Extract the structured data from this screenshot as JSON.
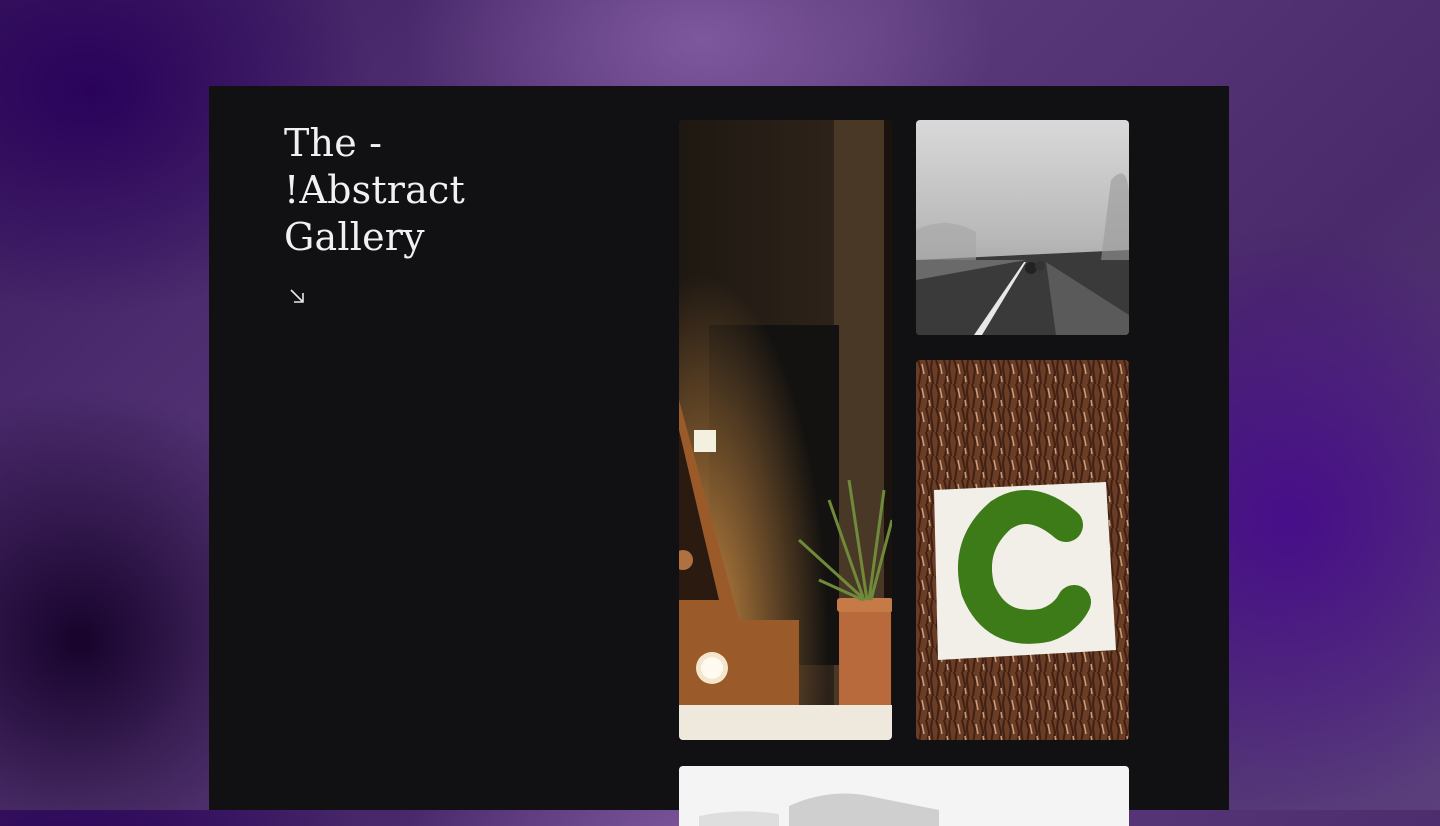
{
  "gallery": {
    "title": "The -\n!Abstract\nGallery",
    "arrow_icon": "arrow-down-right-icon",
    "photos": [
      {
        "subject": "marquee letter lamp with potted plant"
      },
      {
        "subject": "cyclists on foggy road"
      },
      {
        "subject": "painted letter C on tree bark"
      },
      {
        "subject": "misty mountain landscape"
      }
    ]
  },
  "colors": {
    "panel": "#111113",
    "title": "#f1f1f1"
  }
}
